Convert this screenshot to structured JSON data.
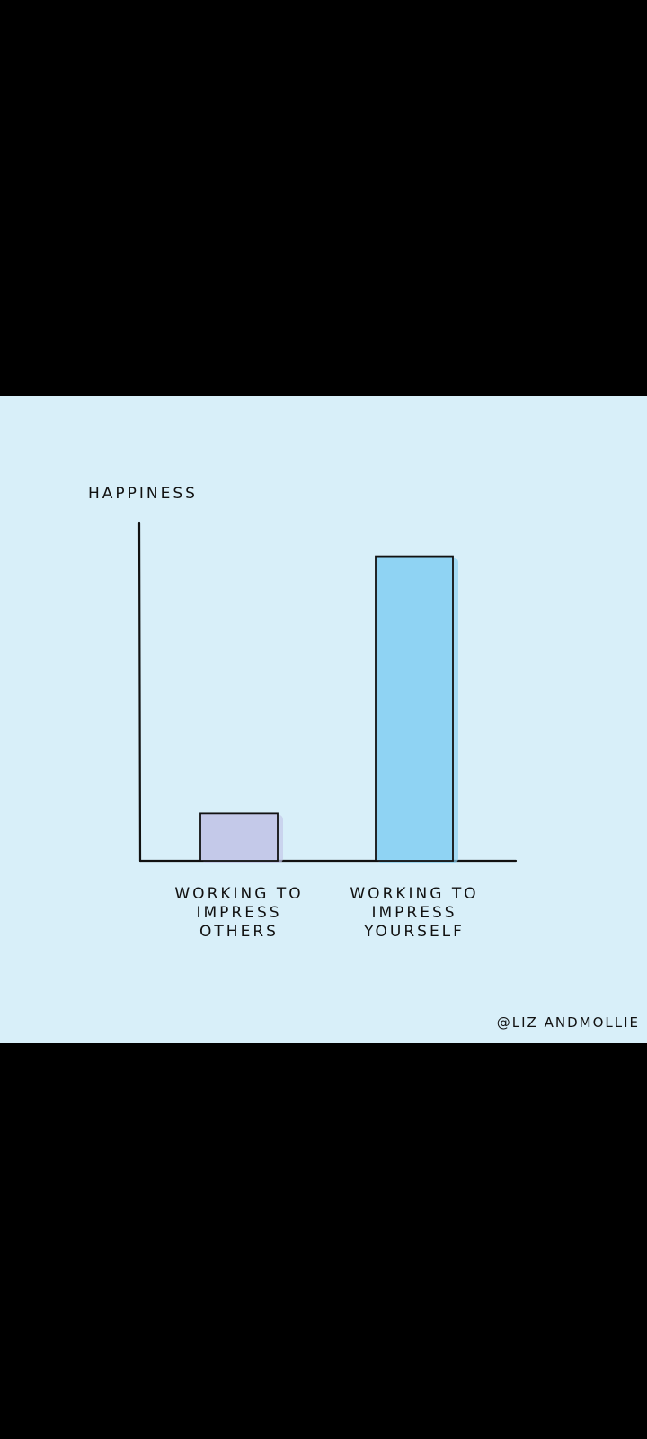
{
  "chart_data": {
    "type": "bar",
    "ylabel": "HAPPINESS",
    "xlabel": "",
    "categories": [
      [
        "WORKING TO",
        "IMPRESS",
        "OTHERS"
      ],
      [
        "WORKING TO",
        "IMPRESS",
        "YOURSELF"
      ]
    ],
    "values": [
      14,
      90
    ],
    "ylim": [
      0,
      100
    ],
    "colors": [
      "#c4c9e9",
      "#8fd3f3"
    ],
    "grid": false
  },
  "credit": "@LIZ ANDMOLLIE",
  "background": "#d8eff9"
}
